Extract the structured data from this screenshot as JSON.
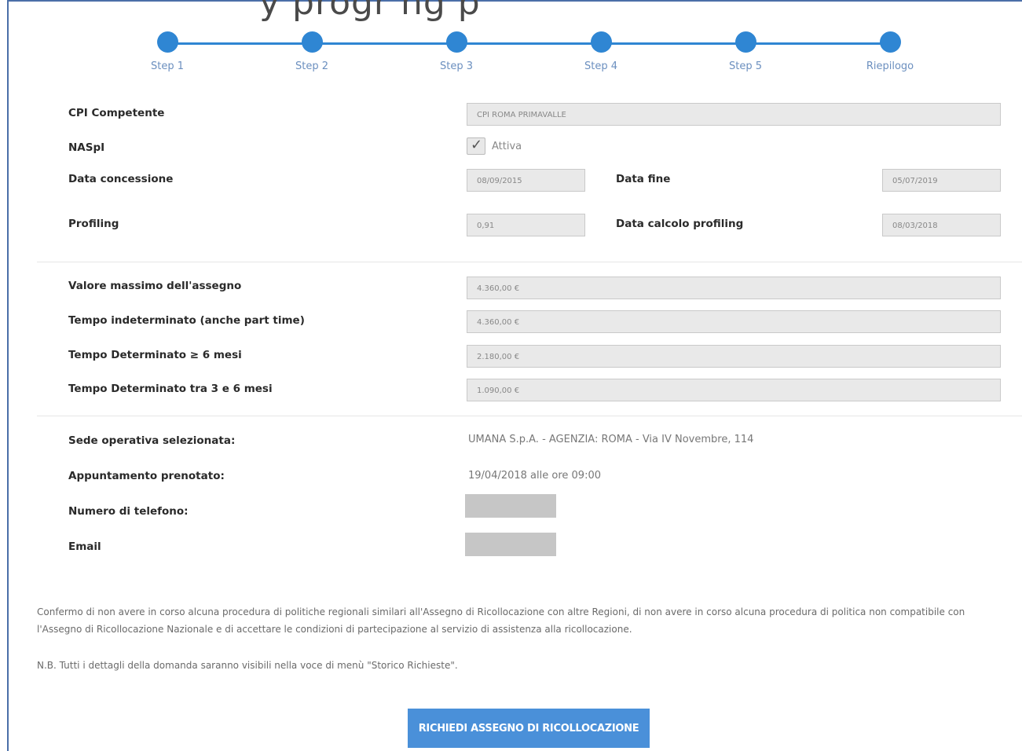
{
  "header": {
    "title_fragment": "y    progr    ng    p"
  },
  "steps": [
    "Step 1",
    "Step 2",
    "Step 3",
    "Step 4",
    "Step 5",
    "Riepilogo"
  ],
  "fields": {
    "cpi_label": "CPI Competente",
    "cpi_value": "CPI ROMA PRIMAVALLE",
    "naspi_label": "NASpI",
    "naspi_check_label": "Attiva",
    "naspi_checked": true,
    "data_concessione_label": "Data concessione",
    "data_concessione_value": "08/09/2015",
    "data_fine_label": "Data fine",
    "data_fine_value": "05/07/2019",
    "profiling_label": "Profiling",
    "profiling_value": "0,91",
    "data_calcolo_label": "Data calcolo profiling",
    "data_calcolo_value": "08/03/2018"
  },
  "amounts": {
    "max_label": "Valore massimo dell'assegno",
    "max_value": "4.360,00 €",
    "indeterminato_label": "Tempo indeterminato (anche part time)",
    "indeterminato_value": "4.360,00 €",
    "det6_label": "Tempo Determinato ≥ 6 mesi",
    "det6_value": "2.180,00 €",
    "det36_label": "Tempo Determinato tra 3 e 6 mesi",
    "det36_value": "1.090,00 €"
  },
  "summary": {
    "sede_label": "Sede operativa selezionata:",
    "sede_value": "UMANA S.p.A. - AGENZIA: ROMA - Via IV Novembre, 114",
    "appuntamento_label": "Appuntamento prenotato:",
    "appuntamento_value": "19/04/2018 alle ore 09:00",
    "telefono_label": "Numero di telefono:",
    "email_label": "Email"
  },
  "notes": {
    "confirm_line1": "Confermo di non avere in corso alcuna procedura di politiche regionali similari all'Assegno di Ricollocazione con altre Regioni, di non avere in corso alcuna procedura di politica non compatibile con",
    "confirm_line2": "l'Assegno di Ricollocazione Nazionale e di accettare le condizioni di partecipazione al servizio di assistenza alla ricollocazione.",
    "nb": "N.B. Tutti i dettagli della domanda saranno visibili nella voce di menù \"Storico Richieste\"."
  },
  "actions": {
    "submit_label": "RICHIEDI ASSEGNO DI RICOLLOCAZIONE"
  },
  "colors": {
    "accent": "#2f86d3",
    "button": "#4a90d9"
  }
}
